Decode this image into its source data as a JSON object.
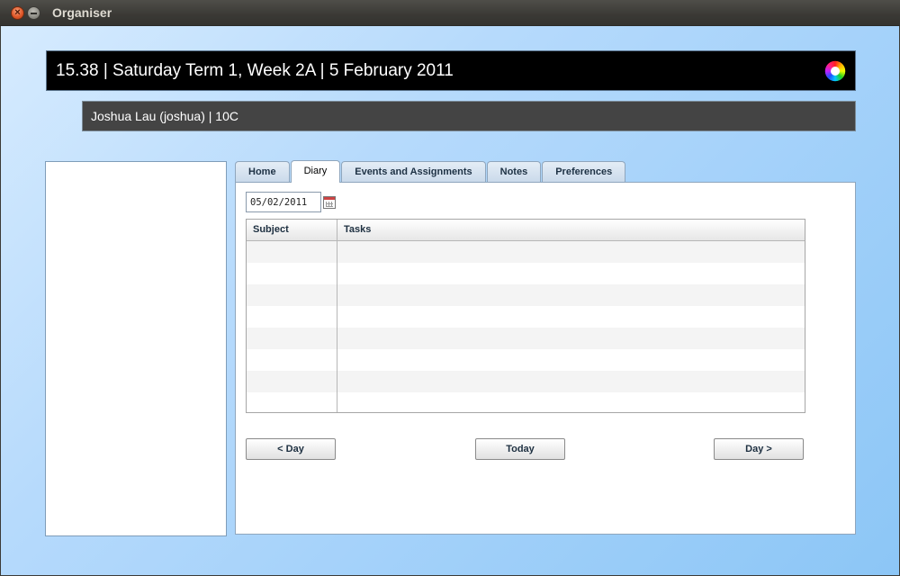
{
  "window": {
    "title": "Organiser"
  },
  "header": {
    "text": "15.38 | Saturday Term 1, Week 2A | 5 February 2011"
  },
  "user": {
    "text": "Joshua Lau (joshua) | 10C"
  },
  "tabs": [
    {
      "label": "Home",
      "active": false
    },
    {
      "label": "Diary",
      "active": true
    },
    {
      "label": "Events and Assignments",
      "active": false
    },
    {
      "label": "Notes",
      "active": false
    },
    {
      "label": "Preferences",
      "active": false
    }
  ],
  "diary": {
    "date_value": "05/02/2011",
    "columns": [
      "Subject",
      "Tasks"
    ],
    "rows": [
      {
        "subject": "",
        "tasks": ""
      },
      {
        "subject": "",
        "tasks": ""
      },
      {
        "subject": "",
        "tasks": ""
      },
      {
        "subject": "",
        "tasks": ""
      },
      {
        "subject": "",
        "tasks": ""
      },
      {
        "subject": "",
        "tasks": ""
      },
      {
        "subject": "",
        "tasks": ""
      },
      {
        "subject": "",
        "tasks": ""
      }
    ],
    "buttons": {
      "prev": "< Day",
      "today": "Today",
      "next": "Day >"
    }
  },
  "icons": {
    "close": "close-icon",
    "minimize": "minimize-icon",
    "logo": "school-logo-icon",
    "calendar": "calendar-icon"
  }
}
